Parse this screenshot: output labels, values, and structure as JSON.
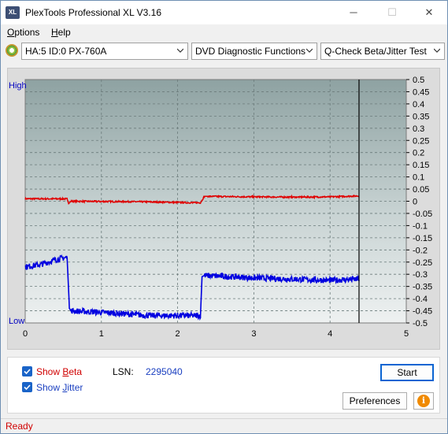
{
  "window": {
    "title": "PlexTools Professional XL V3.16",
    "icon_text": "XL",
    "minimize_glyph": "─",
    "maximize_glyph": "☐",
    "close_glyph": "✕"
  },
  "menu": {
    "options": "ptions",
    "options_accel": "O",
    "help": "elp",
    "help_accel": "H"
  },
  "toolbar": {
    "drive": "HA:5 ID:0  PX-760A",
    "function": "DVD Diagnostic Functions",
    "test": "Q-Check Beta/Jitter Test"
  },
  "chart_data": {
    "type": "line",
    "left_label_top": "High",
    "left_label_bottom": "Low",
    "x_ticks": [
      "0",
      "1",
      "2",
      "3",
      "4",
      "5"
    ],
    "xlim": [
      0,
      5
    ],
    "y_ticks": [
      "0.5",
      "0.45",
      "0.4",
      "0.35",
      "0.3",
      "0.25",
      "0.2",
      "0.15",
      "0.1",
      "0.05",
      "0",
      "-0.05",
      "-0.1",
      "-0.15",
      "-0.2",
      "-0.25",
      "-0.3",
      "-0.35",
      "-0.4",
      "-0.45",
      "-0.5"
    ],
    "ylim": [
      -0.5,
      0.5
    ],
    "end_marker_x": 4.38,
    "grid": true,
    "series": [
      {
        "key": "beta",
        "color": "#e00000",
        "x": [
          0,
          0.55,
          0.57,
          0.6,
          1.5,
          2.2,
          2.3,
          2.35,
          2.4,
          3.0,
          3.5,
          4.0,
          4.38
        ],
        "y": [
          0.01,
          0.01,
          -0.01,
          0.0,
          -0.002,
          -0.006,
          -0.006,
          0.02,
          0.02,
          0.018,
          0.017,
          0.018,
          0.022
        ]
      },
      {
        "key": "jitter",
        "color": "#0000e0",
        "x": [
          0,
          0.2,
          0.4,
          0.55,
          0.58,
          0.6,
          0.9,
          1.2,
          1.6,
          2.0,
          2.3,
          2.32,
          2.35,
          2.7,
          3.0,
          3.5,
          4.0,
          4.38
        ],
        "y": [
          -0.27,
          -0.26,
          -0.24,
          -0.23,
          -0.44,
          -0.45,
          -0.455,
          -0.46,
          -0.47,
          -0.47,
          -0.47,
          -0.31,
          -0.305,
          -0.31,
          -0.315,
          -0.32,
          -0.325,
          -0.32
        ]
      }
    ]
  },
  "options": {
    "show_beta": {
      "before": "Show ",
      "accel": "B",
      "after": "eta",
      "color": "#d00000",
      "checked": true
    },
    "show_jitter": {
      "before": "Show ",
      "accel": "J",
      "after": "itter",
      "color": "#1a3fc0",
      "checked": true
    }
  },
  "lsn": {
    "label": "LSN:",
    "value": "2295040"
  },
  "buttons": {
    "start": "Start",
    "preferences": "Preferences",
    "info_glyph": "i"
  },
  "status": {
    "text": "Ready"
  }
}
